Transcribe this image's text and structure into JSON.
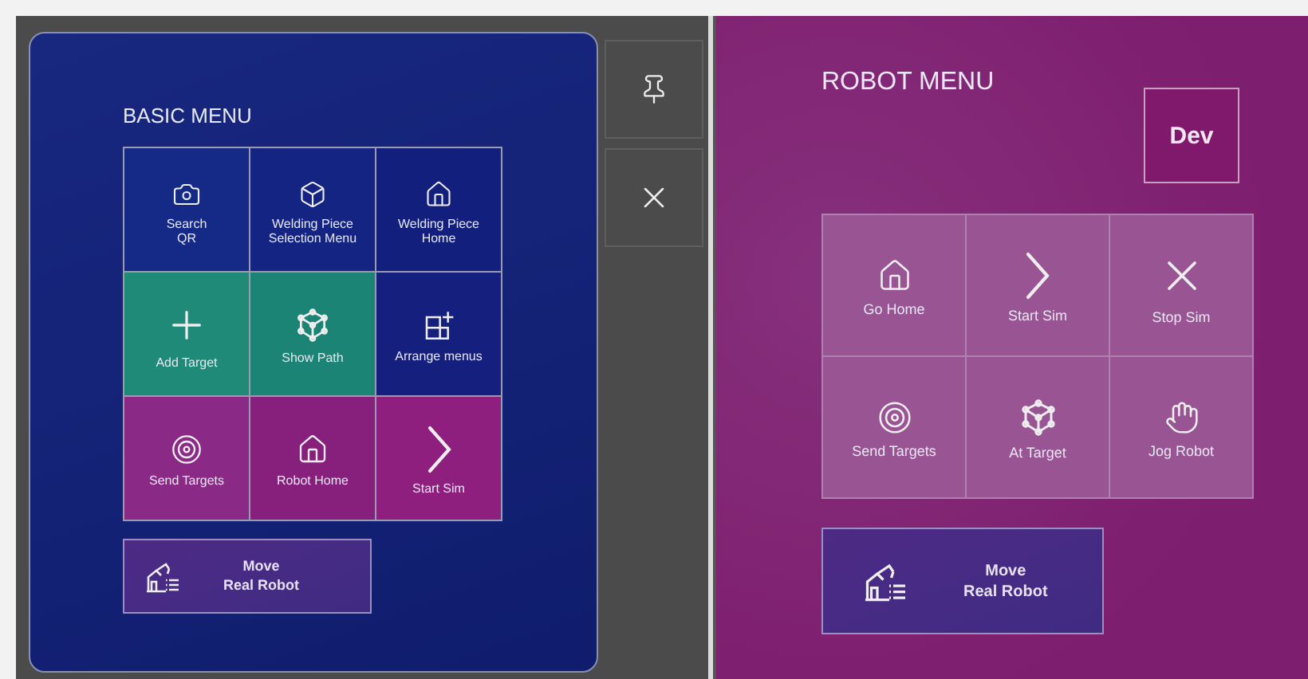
{
  "basic_menu": {
    "title": "BASIC MENU",
    "tiles": [
      {
        "label": "Search\nQR",
        "color": "#152a86"
      },
      {
        "label": "Welding Piece\nSelection Menu",
        "color": "#142482"
      },
      {
        "label": "Welding Piece\nHome",
        "color": "#131f7c"
      },
      {
        "label": "Add Target",
        "color": "#1f8a78"
      },
      {
        "label": "Show Path",
        "color": "#1b8474"
      },
      {
        "label": "Arrange menus",
        "color": "#141f7e"
      },
      {
        "label": "Send Targets",
        "color": "#8a2a86"
      },
      {
        "label": "Robot Home",
        "color": "#86207c"
      },
      {
        "label": "Start Sim",
        "color": "#8e1f7e"
      }
    ],
    "move_button": {
      "label": "Move\nReal Robot"
    }
  },
  "side_buttons": [
    {
      "kind": "pin"
    },
    {
      "kind": "close"
    }
  ],
  "robot_menu": {
    "title": "ROBOT MENU",
    "dev_button": "Dev",
    "tiles": [
      {
        "label": "Go Home"
      },
      {
        "label": "Start Sim"
      },
      {
        "label": "Stop Sim"
      },
      {
        "label": "Send Targets"
      },
      {
        "label": "At Target"
      },
      {
        "label": "Jog Robot"
      }
    ],
    "move_button": {
      "label": "Move\nReal Robot"
    }
  }
}
